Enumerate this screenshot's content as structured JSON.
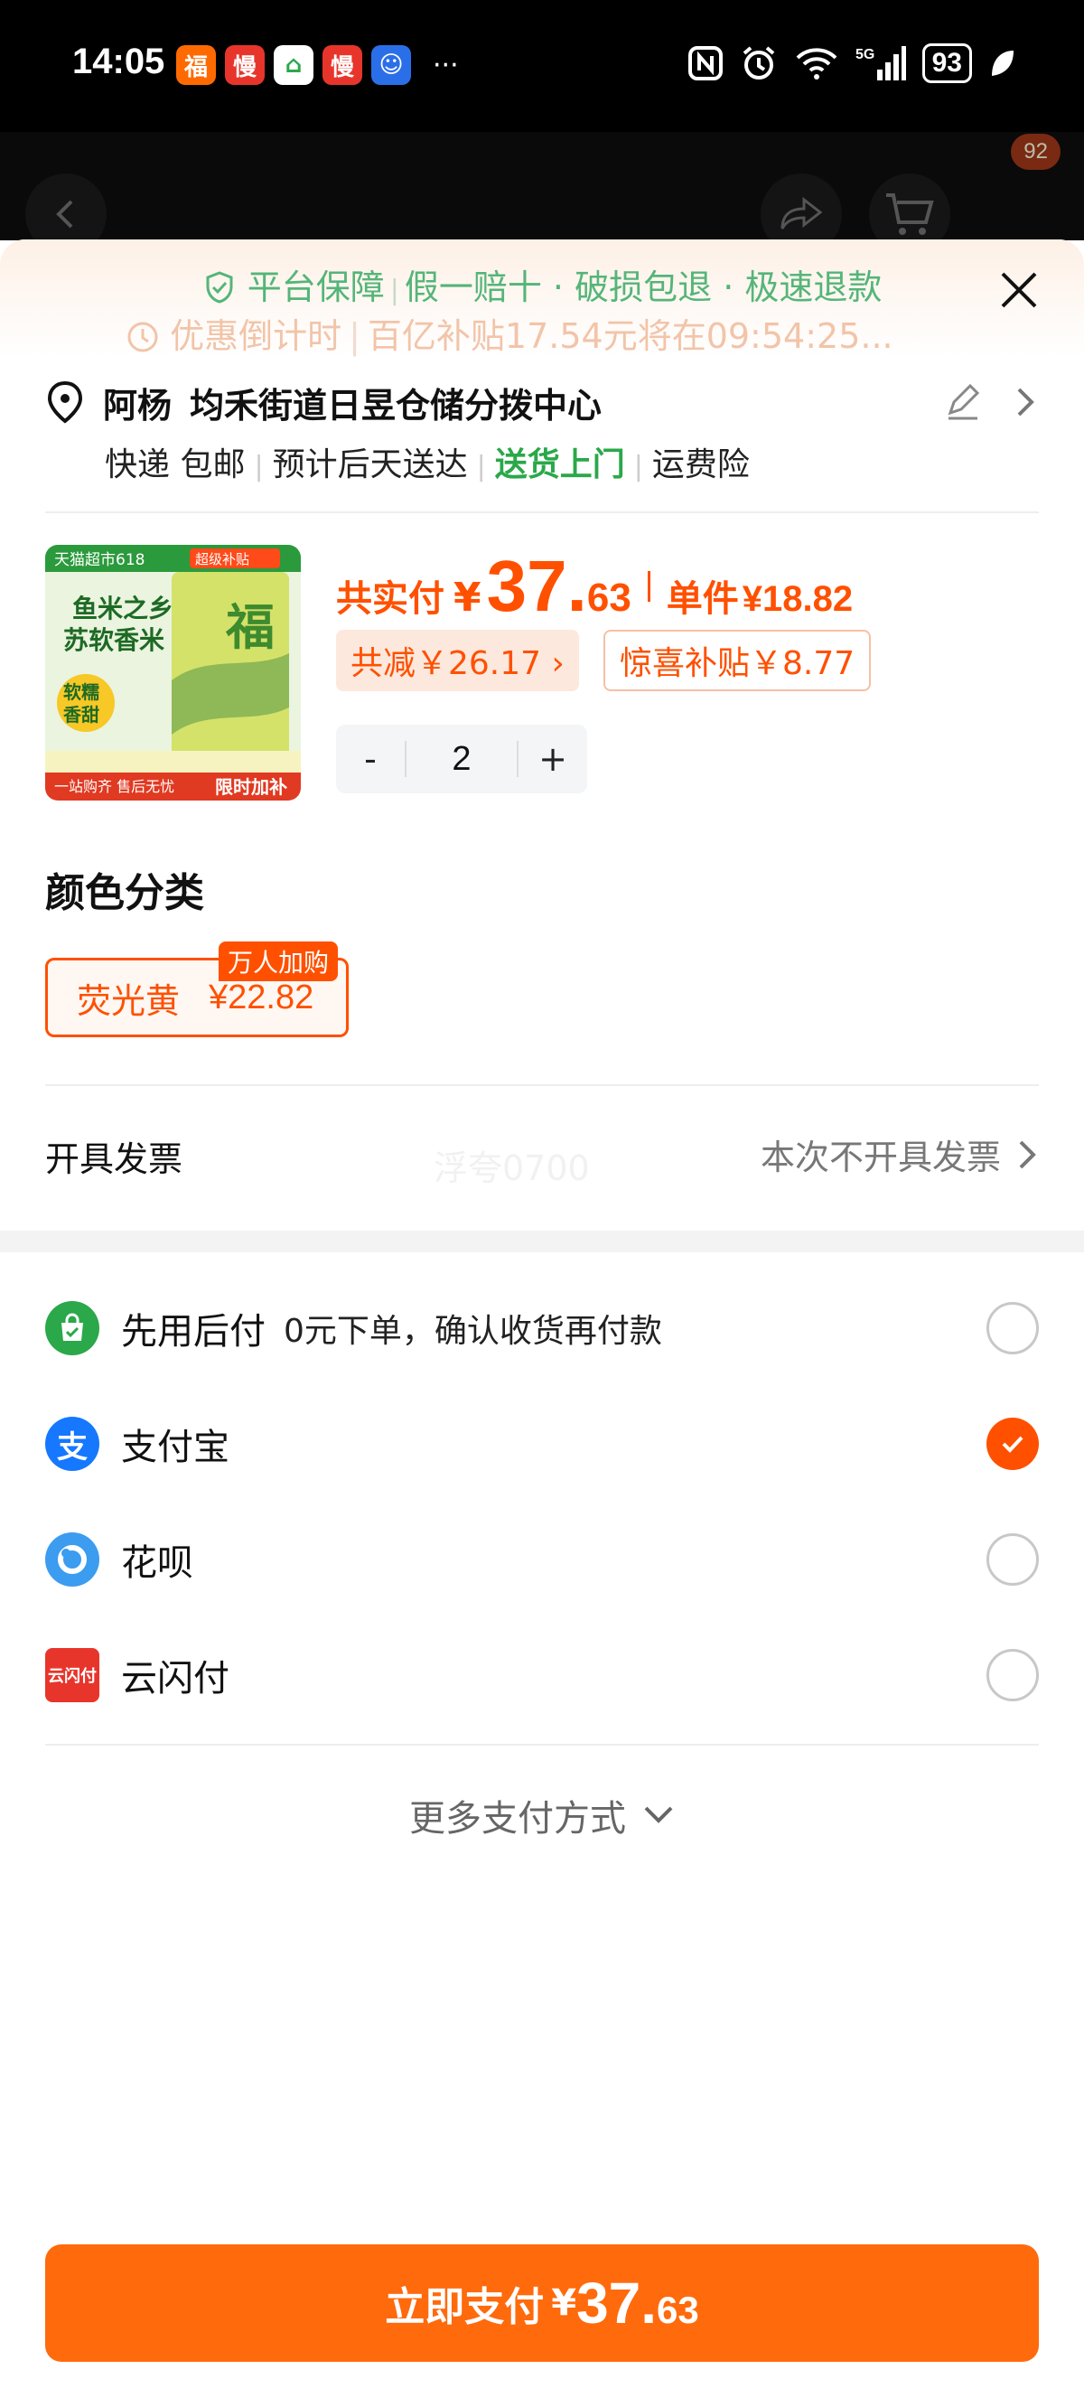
{
  "status_bar": {
    "time": "14:05",
    "apps": [
      {
        "name": "gift-app-icon",
        "glyph": "福",
        "color": "#ff6a00"
      },
      {
        "name": "man-app-icon-1",
        "glyph": "慢",
        "color": "#e8352b"
      },
      {
        "name": "ai-home-app-icon",
        "glyph": "⌂",
        "color": "#ffffff"
      },
      {
        "name": "man-app-icon-2",
        "glyph": "慢",
        "color": "#e8352b"
      },
      {
        "name": "kids-app-icon",
        "glyph": "☺",
        "color": "#2b6fe8"
      }
    ],
    "more": "···",
    "battery": "93"
  },
  "nav": {
    "badge_count": "92"
  },
  "header": {
    "guarantee_label": "平台保障",
    "guarantee_items": [
      "假一赔十",
      "破损包退",
      "极速退款"
    ],
    "countdown_label": "优惠倒计时",
    "countdown_text": "百亿补贴17.54元将在09:54:25..."
  },
  "address": {
    "name": "阿杨",
    "location": "均禾街道日昱仓储分拨中心",
    "shipping": [
      "快递 包邮",
      "预计后天送达",
      "送货上门",
      "运费险"
    ]
  },
  "product": {
    "thumb_tag": "天猫超市618",
    "thumb_tag2": "超级补贴",
    "thumb_headline": "鱼米之乡 苏软香米",
    "thumb_badge": "软糯香甜",
    "thumb_bottom": "一站购齐 售后无忧",
    "thumb_corner": "限时加补",
    "total_label": "共实付",
    "total_yen": "¥",
    "total_int": "37.",
    "total_dec": "63",
    "unit_label": "单件",
    "unit_price": "¥18.82",
    "discount": "共减￥26.17 ›",
    "surprise": "惊喜补贴￥8.77",
    "minus": "-",
    "quantity": "2",
    "plus": "+"
  },
  "options": {
    "title": "颜色分类",
    "chip_name": "荧光黄",
    "chip_price": "¥22.82",
    "chip_badge": "万人加购"
  },
  "invoice": {
    "label": "开具发票",
    "watermark": "浮夸0700",
    "value": "本次不开具发票"
  },
  "payments": [
    {
      "name": "先用后付",
      "sub": "0元下单，确认收货再付款",
      "selected": false
    },
    {
      "name": "支付宝",
      "sub": "",
      "selected": true
    },
    {
      "name": "花呗",
      "sub": "",
      "selected": false
    },
    {
      "name": "云闪付",
      "sub": "",
      "selected": false
    }
  ],
  "more_payment": "更多支付方式",
  "pay_button": {
    "label": "立即支付",
    "yen": "¥",
    "int": "37.",
    "dec": "63"
  },
  "colors": {
    "accent": "#ff5000",
    "button": "#ff6a0c",
    "green": "#2aa84a",
    "alipay": "#1677ff"
  }
}
